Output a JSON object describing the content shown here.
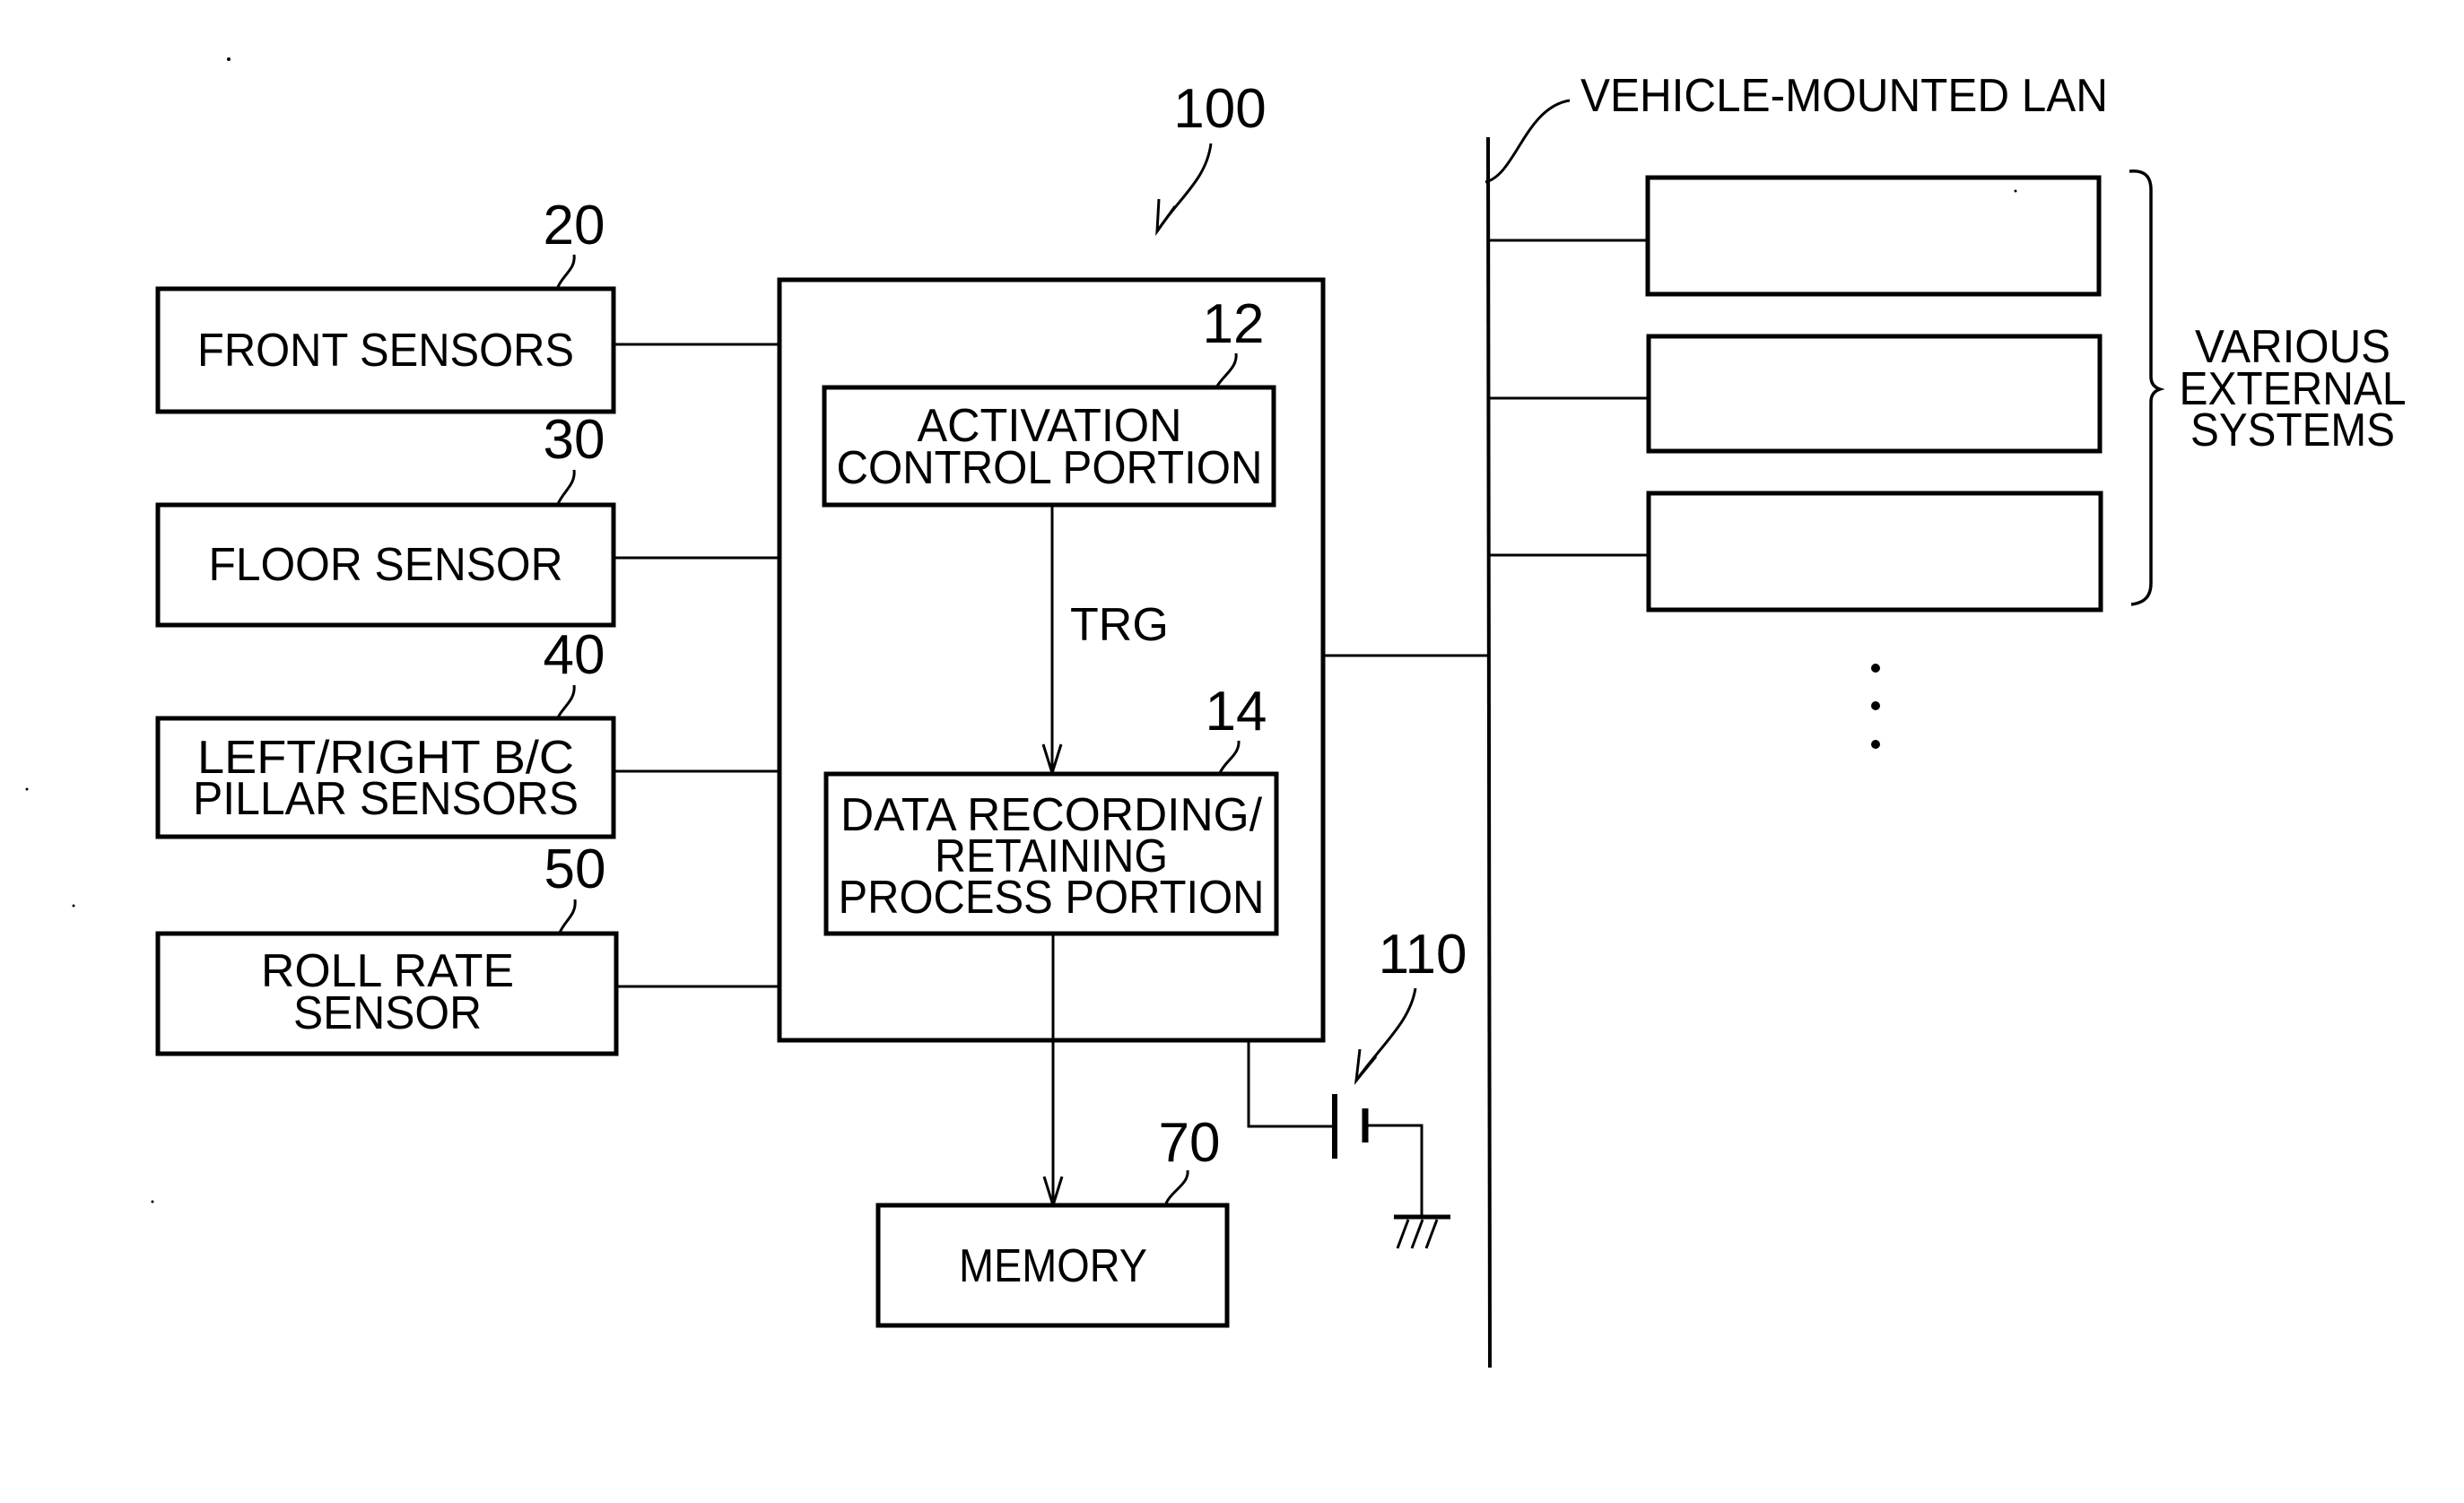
{
  "figure": {
    "system_ref": "100",
    "lan_label": "VEHICLE-MOUNTED LAN",
    "signal_label": "TRG",
    "sensors": [
      {
        "ref": "20",
        "lines": [
          "FRONT SENSORS"
        ]
      },
      {
        "ref": "30",
        "lines": [
          "FLOOR SENSOR"
        ]
      },
      {
        "ref": "40",
        "lines": [
          "LEFT/RIGHT B/C",
          "PILLAR SENSORS"
        ]
      },
      {
        "ref": "50",
        "lines": [
          "ROLL RATE",
          "SENSOR"
        ]
      }
    ],
    "activation": {
      "ref": "12",
      "lines": [
        "ACTIVATION",
        "CONTROL PORTION"
      ]
    },
    "recording": {
      "ref": "14",
      "lines": [
        "DATA RECORDING/",
        "RETAINING",
        "PROCESS PORTION"
      ]
    },
    "memory": {
      "ref": "70",
      "label": "MEMORY"
    },
    "battery": {
      "ref": "110"
    },
    "external": {
      "lines": [
        "VARIOUS",
        "EXTERNAL",
        "SYSTEMS"
      ],
      "box_count": 3,
      "more_indicator": "⋮"
    }
  }
}
